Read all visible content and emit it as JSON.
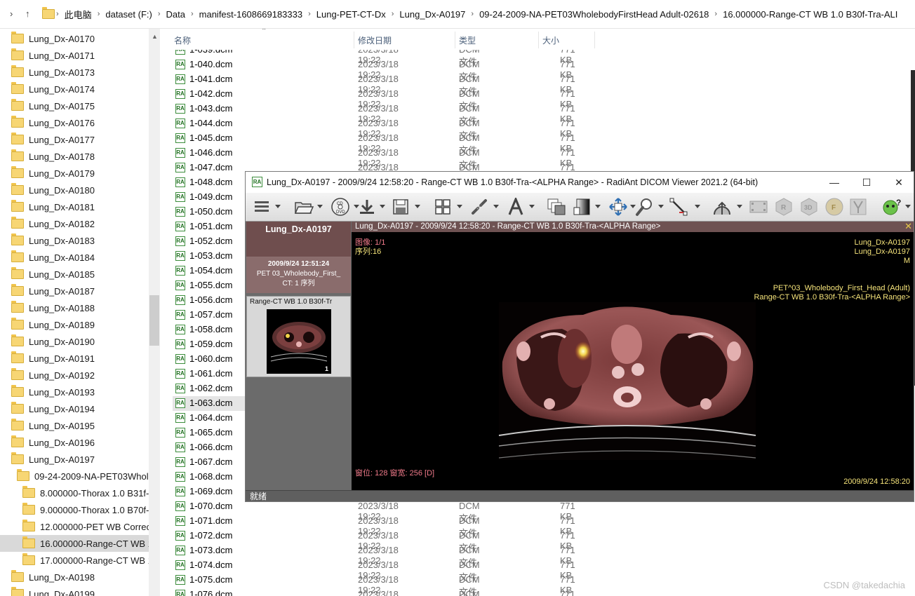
{
  "address_bar": {
    "crumbs": [
      "此电脑",
      "dataset (F:)",
      "Data",
      "manifest-1608669183333",
      "Lung-PET-CT-Dx",
      "Lung_Dx-A0197",
      "09-24-2009-NA-PET03WholebodyFirstHead Adult-02618",
      "16.000000-Range-CT WB  1.0  B30f-Tra-ALI"
    ]
  },
  "tree": {
    "items": [
      {
        "label": "Lung_Dx-A0170",
        "level": 0
      },
      {
        "label": "Lung_Dx-A0171",
        "level": 0
      },
      {
        "label": "Lung_Dx-A0173",
        "level": 0
      },
      {
        "label": "Lung_Dx-A0174",
        "level": 0
      },
      {
        "label": "Lung_Dx-A0175",
        "level": 0
      },
      {
        "label": "Lung_Dx-A0176",
        "level": 0
      },
      {
        "label": "Lung_Dx-A0177",
        "level": 0
      },
      {
        "label": "Lung_Dx-A0178",
        "level": 0
      },
      {
        "label": "Lung_Dx-A0179",
        "level": 0
      },
      {
        "label": "Lung_Dx-A0180",
        "level": 0
      },
      {
        "label": "Lung_Dx-A0181",
        "level": 0
      },
      {
        "label": "Lung_Dx-A0182",
        "level": 0
      },
      {
        "label": "Lung_Dx-A0183",
        "level": 0
      },
      {
        "label": "Lung_Dx-A0184",
        "level": 0
      },
      {
        "label": "Lung_Dx-A0185",
        "level": 0
      },
      {
        "label": "Lung_Dx-A0187",
        "level": 0
      },
      {
        "label": "Lung_Dx-A0188",
        "level": 0
      },
      {
        "label": "Lung_Dx-A0189",
        "level": 0
      },
      {
        "label": "Lung_Dx-A0190",
        "level": 0
      },
      {
        "label": "Lung_Dx-A0191",
        "level": 0
      },
      {
        "label": "Lung_Dx-A0192",
        "level": 0
      },
      {
        "label": "Lung_Dx-A0193",
        "level": 0
      },
      {
        "label": "Lung_Dx-A0194",
        "level": 0
      },
      {
        "label": "Lung_Dx-A0195",
        "level": 0
      },
      {
        "label": "Lung_Dx-A0196",
        "level": 0
      },
      {
        "label": "Lung_Dx-A0197",
        "level": 0
      },
      {
        "label": "09-24-2009-NA-PET03Wholeb",
        "level": 1
      },
      {
        "label": "8.000000-Thorax  1.0  B31f-",
        "level": 2
      },
      {
        "label": "9.000000-Thorax  1.0  B70f-",
        "level": 2
      },
      {
        "label": "12.000000-PET WB Correcte",
        "level": 2
      },
      {
        "label": "16.000000-Range-CT WB  1",
        "level": 2,
        "selected": true
      },
      {
        "label": "17.000000-Range-CT WB  1",
        "level": 2
      },
      {
        "label": "Lung_Dx-A0198",
        "level": 0
      },
      {
        "label": "Lung_Dx-A0199",
        "level": 0
      }
    ]
  },
  "list": {
    "columns": {
      "name": "名称",
      "date": "修改日期",
      "type": "类型",
      "size": "大小"
    },
    "files": [
      {
        "name": "1-039.dcm",
        "date": "2023/3/18 19:22",
        "type": "DCM 文件",
        "size": "771 KB"
      },
      {
        "name": "1-040.dcm",
        "date": "2023/3/18 19:22",
        "type": "DCM 文件",
        "size": "771 KB"
      },
      {
        "name": "1-041.dcm",
        "date": "2023/3/18 19:22",
        "type": "DCM 文件",
        "size": "771 KB"
      },
      {
        "name": "1-042.dcm",
        "date": "2023/3/18 19:22",
        "type": "DCM 文件",
        "size": "771 KB"
      },
      {
        "name": "1-043.dcm",
        "date": "2023/3/18 19:22",
        "type": "DCM 文件",
        "size": "771 KB"
      },
      {
        "name": "1-044.dcm",
        "date": "2023/3/18 19:22",
        "type": "DCM 文件",
        "size": "771 KB"
      },
      {
        "name": "1-045.dcm",
        "date": "2023/3/18 19:22",
        "type": "DCM 文件",
        "size": "771 KB"
      },
      {
        "name": "1-046.dcm",
        "date": "2023/3/18 19:22",
        "type": "DCM 文件",
        "size": "771 KB"
      },
      {
        "name": "1-047.dcm",
        "date": "2023/3/18 19:22",
        "type": "DCM 文件",
        "size": "771 KB"
      },
      {
        "name": "1-048.dcm",
        "date": "",
        "type": "",
        "size": ""
      },
      {
        "name": "1-049.dcm",
        "date": "",
        "type": "",
        "size": ""
      },
      {
        "name": "1-050.dcm",
        "date": "",
        "type": "",
        "size": ""
      },
      {
        "name": "1-051.dcm",
        "date": "",
        "type": "",
        "size": ""
      },
      {
        "name": "1-052.dcm",
        "date": "",
        "type": "",
        "size": ""
      },
      {
        "name": "1-053.dcm",
        "date": "",
        "type": "",
        "size": ""
      },
      {
        "name": "1-054.dcm",
        "date": "",
        "type": "",
        "size": ""
      },
      {
        "name": "1-055.dcm",
        "date": "",
        "type": "",
        "size": ""
      },
      {
        "name": "1-056.dcm",
        "date": "",
        "type": "",
        "size": ""
      },
      {
        "name": "1-057.dcm",
        "date": "",
        "type": "",
        "size": ""
      },
      {
        "name": "1-058.dcm",
        "date": "",
        "type": "",
        "size": ""
      },
      {
        "name": "1-059.dcm",
        "date": "",
        "type": "",
        "size": ""
      },
      {
        "name": "1-060.dcm",
        "date": "",
        "type": "",
        "size": ""
      },
      {
        "name": "1-061.dcm",
        "date": "",
        "type": "",
        "size": ""
      },
      {
        "name": "1-062.dcm",
        "date": "",
        "type": "",
        "size": ""
      },
      {
        "name": "1-063.dcm",
        "date": "",
        "type": "",
        "size": "",
        "highlighted": true
      },
      {
        "name": "1-064.dcm",
        "date": "",
        "type": "",
        "size": ""
      },
      {
        "name": "1-065.dcm",
        "date": "",
        "type": "",
        "size": ""
      },
      {
        "name": "1-066.dcm",
        "date": "",
        "type": "",
        "size": ""
      },
      {
        "name": "1-067.dcm",
        "date": "",
        "type": "",
        "size": ""
      },
      {
        "name": "1-068.dcm",
        "date": "",
        "type": "",
        "size": ""
      },
      {
        "name": "1-069.dcm",
        "date": "",
        "type": "",
        "size": ""
      },
      {
        "name": "1-070.dcm",
        "date": "2023/3/18 19:22",
        "type": "DCM 文件",
        "size": "771 KB"
      },
      {
        "name": "1-071.dcm",
        "date": "2023/3/18 19:22",
        "type": "DCM 文件",
        "size": "771 KB"
      },
      {
        "name": "1-072.dcm",
        "date": "2023/3/18 19:22",
        "type": "DCM 文件",
        "size": "771 KB"
      },
      {
        "name": "1-073.dcm",
        "date": "2023/3/18 19:22",
        "type": "DCM 文件",
        "size": "771 KB"
      },
      {
        "name": "1-074.dcm",
        "date": "2023/3/18 19:22",
        "type": "DCM 文件",
        "size": "771 KB"
      },
      {
        "name": "1-075.dcm",
        "date": "2023/3/18 19:22",
        "type": "DCM 文件",
        "size": "771 KB"
      },
      {
        "name": "1-076.dcm",
        "date": "2023/3/18 19:22",
        "type": "DCM 文件",
        "size": "771 KB"
      }
    ]
  },
  "radiant": {
    "title": "Lung_Dx-A0197 - 2009/9/24 12:58:20 - Range-CT WB  1.0  B30f-Tra-<ALPHA Range> - RadiAnt DICOM Viewer 2021.2 (64-bit)",
    "logo_text": "RA",
    "toolbar_icons": [
      "menu-icon",
      "open-folder-icon",
      "cd-dvd-icon",
      "download-icon",
      "save-icon",
      "layout-grid-icon",
      "link-icon",
      "text-annotation-icon",
      "series-stack-icon",
      "window-level-icon",
      "pan-icon",
      "zoom-icon",
      "measure-icon",
      "fusion-icon",
      "cine-icon",
      "mpr-icon",
      "3d-icon",
      "face-icon",
      "dental-icon",
      "help-icon"
    ],
    "patient_name": "Lung_Dx-A0197",
    "study_date": "2009/9/24 12:51:24",
    "study_desc": "PET 03_Wholebody_First_",
    "study_count": "CT: 1 序列",
    "series_label": "Range-CT WB  1.0  B30f-Tr",
    "series_count": "1",
    "viewer_bar": "Lung_Dx-A0197 - 2009/9/24 12:58:20 - Range-CT WB  1.0  B30f-Tra-<ALPHA Range>",
    "overlay": {
      "image_index": "图像: 1/1",
      "series_index": "序列:16",
      "top_right": [
        "Lung_Dx-A0197",
        "Lung_Dx-A0197",
        "M"
      ],
      "mid_right": [
        "PET^03_Wholebody_First_Head (Adult)",
        "Range-CT WB  1.0  B30f-Tra-<ALPHA Range>"
      ],
      "window": "窗位: 128 窗宽: 256 [D]",
      "datetime": "2009/9/24 12:58:20"
    },
    "status": "就绪",
    "colors": {
      "patient_bg": "#6f4e4e",
      "overlay_yellow": "#f5e37a",
      "overlay_pink": "#f07a8a"
    }
  },
  "watermark": "CSDN @takedachia"
}
